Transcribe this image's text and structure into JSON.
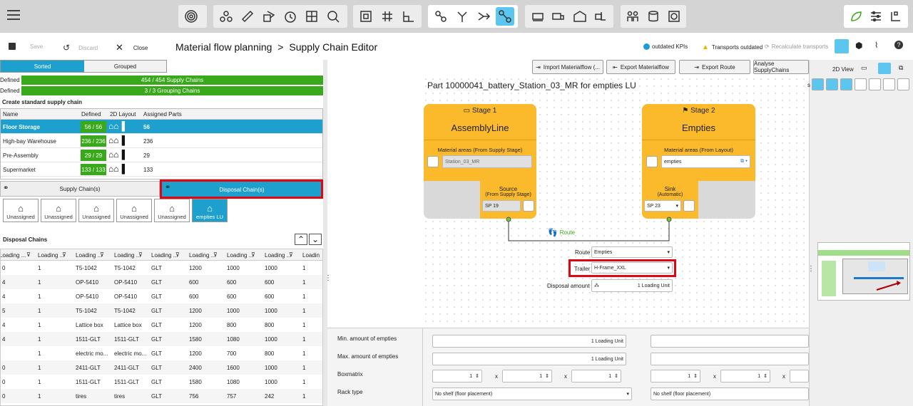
{
  "toolbar": {
    "groups": [
      [
        "radar-icon"
      ],
      [
        "flow-icon",
        "ruler-icon",
        "boxes-icon",
        "clock-icon",
        "shelf-icon",
        "search-chart-icon"
      ],
      [
        "frame-icon",
        "grid-icon",
        "layout-icon"
      ],
      [
        "chain-icon",
        "fork-icon",
        "merge-icon",
        "route-icon"
      ],
      [
        "pallet-icon",
        "truck-icon",
        "warehouse-icon",
        "forklift-icon"
      ],
      [
        "people-icon",
        "coins-icon",
        "target-icon"
      ],
      [
        "leaf-icon",
        "sliders-icon",
        "hf-icon"
      ]
    ]
  },
  "actions": {
    "save": "Save",
    "discard": "Discard",
    "close": "Close"
  },
  "breadcrumb": {
    "parent": "Material flow planning",
    "separator": ">",
    "current": "Supply Chain Editor"
  },
  "status": {
    "kpis": "outdated KPIs",
    "transports": "Transports outdated",
    "recalc": "Recalculate transports"
  },
  "left": {
    "toggle": {
      "sorted": "Sorted",
      "grouped": "Grouped"
    },
    "defined_label": "Defined",
    "defined_bars": [
      "454 / 454 Supply Chains",
      "3 / 3 Grouping Chains"
    ],
    "section_title": "Create standard supply chain",
    "std_headers": [
      "Name",
      "Defined",
      "2D Layout",
      "Assigned Parts"
    ],
    "std_rows": [
      {
        "name": "Floor Storage",
        "defined": "56 / 56",
        "parts": "56"
      },
      {
        "name": "High-bay Warehouse",
        "defined": "236 / 236",
        "parts": "236"
      },
      {
        "name": "Pre-Assembly",
        "defined": "29 / 29",
        "parts": "29"
      },
      {
        "name": "Supermarket",
        "defined": "133 / 133",
        "parts": "133"
      }
    ],
    "chain_tabs": {
      "supply": "Supply Chain(s)",
      "disposal": "Disposal Chain(s)"
    },
    "slots": [
      "Unassigned",
      "Unassigned",
      "Unassigned",
      "Unassigned",
      "Unassigned",
      "empties LU"
    ],
    "disposal_title": "Disposal Chains",
    "disp_headers": [
      "Loading ...",
      "Loading ...",
      "Loading ...",
      "Loading ...",
      "Loading ...",
      "Loading ...",
      "Loading ...",
      "Loading ...",
      "Loadin"
    ],
    "disp_rows": [
      [
        "0",
        "1",
        "T5-1042",
        "T5-1042",
        "GLT",
        "1200",
        "1000",
        "1000",
        "1"
      ],
      [
        "4",
        "1",
        "OP-5410",
        "OP-5410",
        "GLT",
        "600",
        "600",
        "600",
        "1"
      ],
      [
        "4",
        "1",
        "OP-5410",
        "OP-5410",
        "GLT",
        "600",
        "600",
        "600",
        "1"
      ],
      [
        "5",
        "1",
        "T5-1042",
        "T5-1042",
        "GLT",
        "1200",
        "1000",
        "1000",
        "1"
      ],
      [
        "4",
        "1",
        "Lattice box",
        "Lattice box",
        "GLT",
        "1200",
        "800",
        "800",
        "1"
      ],
      [
        "4",
        "1",
        "1511-GLT",
        "1511-GLT",
        "GLT",
        "1580",
        "1080",
        "1000",
        "1"
      ],
      [
        "",
        "1",
        "electric mo...",
        "electric mo...",
        "GLT",
        "1200",
        "700",
        "800",
        "1"
      ],
      [
        "0",
        "1",
        "2411-GLT",
        "2411-GLT",
        "GLT",
        "2400",
        "1600",
        "1000",
        "1"
      ],
      [
        "0",
        "1",
        "1511-GLT",
        "1511-GLT",
        "GLT",
        "1580",
        "1080",
        "1000",
        "1"
      ],
      [
        "0",
        "1",
        "tires",
        "tires",
        "GLT",
        "756",
        "757",
        "242",
        "1"
      ]
    ]
  },
  "top_buttons": [
    "Import Materialflow (...",
    "Export Materialflow",
    "Export Route",
    "Analyse SupplyChains"
  ],
  "editor": {
    "title": "Part 10000041_battery_Station_03_MR for empties LU",
    "stage1": {
      "label": "Stage 1",
      "name": "AssemblyLine",
      "areas_label": "Material areas (From Supply Stage)",
      "area_value": "Station_03_MR",
      "src_title": "Source",
      "src_sub": "(From Supply Stage)",
      "src_value": "SP 19"
    },
    "stage2": {
      "label": "Stage 2",
      "name": "Empties",
      "areas_label": "Material areas (From Layout)",
      "area_value": "empties",
      "sink_title": "Sink",
      "sink_sub": "(Automatic)",
      "sink_value": "SP 23"
    },
    "route_link": "Route",
    "route_label": "Route",
    "route_value": "Empties",
    "trailer_label": "Trailer",
    "trailer_value": "H-Frame_XXL",
    "disposal_label": "Disposal amount",
    "disposal_value": "1 Loading Unit"
  },
  "bottom": {
    "min_label": "Min. amount of empties",
    "min_value": "1 Loading Unit",
    "max_label": "Max. amount of empties",
    "max_value": "1 Loading Unit",
    "box_label": "Boxmatrix",
    "box_values": [
      "1",
      "1",
      "1",
      "1",
      "1"
    ],
    "x": "x",
    "rack_label": "Rack type",
    "rack_value": "No shelf (floor placement)"
  },
  "right": {
    "view": "2D View",
    "s": "s"
  }
}
